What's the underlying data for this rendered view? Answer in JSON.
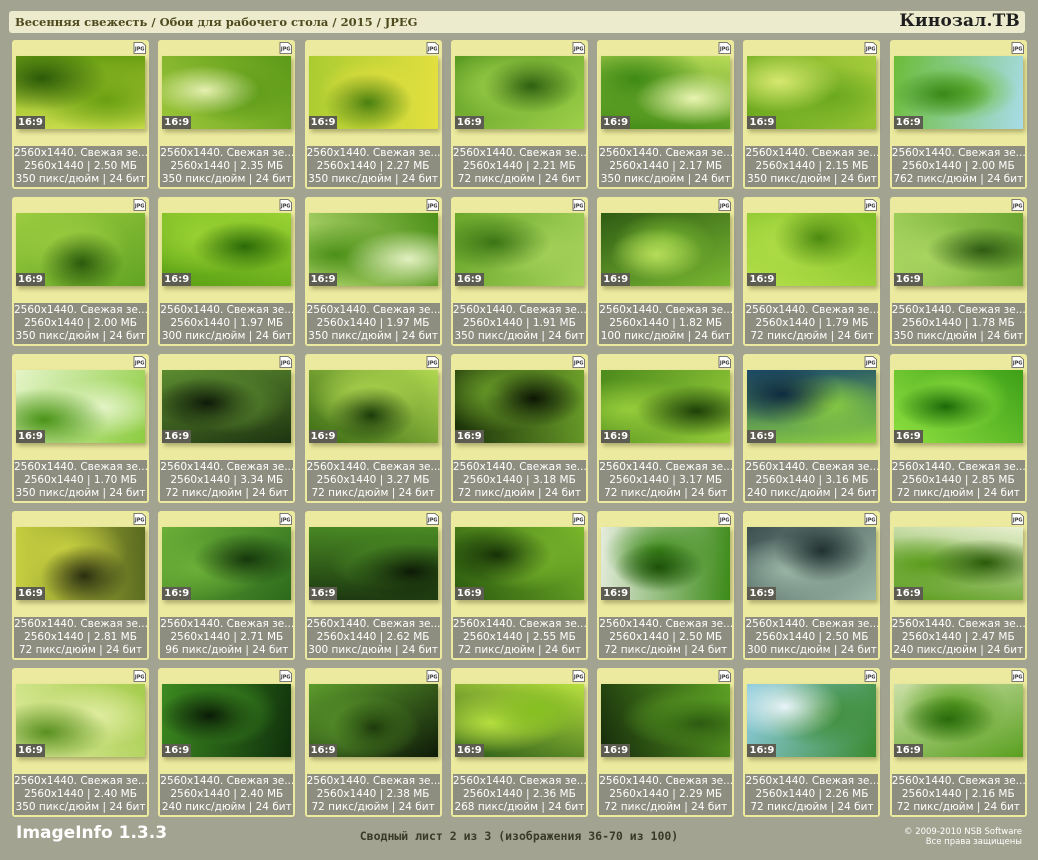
{
  "header": {
    "title": "Весенняя свежесть / Обои для рабочего стола / 2015 / JPEG",
    "brand": "Кинозал.ТВ"
  },
  "footer": {
    "app_name": "ImageInfo 1.3.3",
    "page_info": "Сводный лист 2 из 3 (изображения 36-70 из 100)",
    "copyright_line1": "© 2009-2010 NSB Software",
    "copyright_line2": "Все права защищены"
  },
  "badge_label": "16:9",
  "format_icon_label": "JPG",
  "thumbnails": [
    {
      "line1": "2560x1440. Свежая зе...",
      "line2": "2560x1440 | 2.50 МБ",
      "line3": "350 пикс/дюйм | 24 бит",
      "colors": [
        "#c8dc4a",
        "#6aa012",
        "#2c5a08"
      ]
    },
    {
      "line1": "2560x1440. Свежая зе...",
      "line2": "2560x1440 | 2.35 МБ",
      "line3": "350 пикс/дюйм | 24 бит",
      "colors": [
        "#9cc63a",
        "#5c9a18",
        "#e6f0b0"
      ]
    },
    {
      "line1": "2560x1440. Свежая зе...",
      "line2": "2560x1440 | 2.27 МБ",
      "line3": "350 пикс/дюйм | 24 бит",
      "colors": [
        "#aacc30",
        "#e4e040",
        "#4a8010"
      ]
    },
    {
      "line1": "2560x1440. Свежая зе...",
      "line2": "2560x1440 | 2.21 МБ",
      "line3": "72 пикс/дюйм | 24 бит",
      "colors": [
        "#5a9a22",
        "#9ed04a",
        "#2e6010"
      ]
    },
    {
      "line1": "2560x1440. Свежая зе...",
      "line2": "2560x1440 | 2.17 МБ",
      "line3": "350 пикс/дюйм | 24 бит",
      "colors": [
        "#b8da58",
        "#3e8a14",
        "#e8f4b0"
      ]
    },
    {
      "line1": "2560x1440. Свежая зе...",
      "line2": "2560x1440 | 2.15 МБ",
      "line3": "350 пикс/дюйм | 24 бит",
      "colors": [
        "#a6cc3c",
        "#6aa81e",
        "#d6e870"
      ]
    },
    {
      "line1": "2560x1440. Свежая зе...",
      "line2": "2560x1440 | 2.00 МБ",
      "line3": "762 пикс/дюйм | 24 бит",
      "colors": [
        "#a8dce8",
        "#6cbc38",
        "#3a8818"
      ]
    },
    {
      "line1": "2560x1440. Свежая зе...",
      "line2": "2560x1440 | 2.00 МБ",
      "line3": "350 пикс/дюйм | 24 бит",
      "colors": [
        "#62a424",
        "#9ccc40",
        "#2a5a0c"
      ]
    },
    {
      "line1": "2560x1440. Свежая зе...",
      "line2": "2560x1440 | 1.97 МБ",
      "line3": "300 пикс/дюйм | 24 бит",
      "colors": [
        "#58a014",
        "#9ad232",
        "#2c6a08"
      ]
    },
    {
      "line1": "2560x1440. Свежая зе...",
      "line2": "2560x1440 | 1.97 МБ",
      "line3": "350 пикс/дюйм | 24 бит",
      "colors": [
        "#b4d870",
        "#4c9018",
        "#e2f0c0"
      ]
    },
    {
      "line1": "2560x1440. Свежая зе...",
      "line2": "2560x1440 | 1.91 МБ",
      "line3": "350 пикс/дюйм | 24 бит",
      "colors": [
        "#6aa82c",
        "#a6d25a",
        "#3a7414"
      ]
    },
    {
      "line1": "2560x1440. Свежая зе...",
      "line2": "2560x1440 | 1.82 МБ",
      "line3": "100 пикс/дюйм | 24 бит",
      "colors": [
        "#2e5c14",
        "#7ab832",
        "#b6dc5a"
      ]
    },
    {
      "line1": "2560x1440. Свежая зе...",
      "line2": "2560x1440 | 1.79 МБ",
      "line3": "72 пикс/дюйм | 24 бит",
      "colors": [
        "#7cbc24",
        "#b4e04a",
        "#4c8a10"
      ]
    },
    {
      "line1": "2560x1440. Свежая зе...",
      "line2": "2560x1440 | 1.78 МБ",
      "line3": "350 пикс/дюйм | 24 бит",
      "colors": [
        "#6aa630",
        "#a8d460",
        "#2e5a12"
      ]
    },
    {
      "line1": "2560x1440. Свежая зе...",
      "line2": "2560x1440 | 1.70 МБ",
      "line3": "350 пикс/дюйм | 24 бит",
      "colors": [
        "#8ccc40",
        "#e4f4c8",
        "#4a9418"
      ]
    },
    {
      "line1": "2560x1440. Свежая зе...",
      "line2": "2560x1440 | 3.34 МБ",
      "line3": "72 пикс/дюйм | 24 бит",
      "colors": [
        "#1e3410",
        "#5c8c30",
        "#0e1a08"
      ]
    },
    {
      "line1": "2560x1440. Свежая зе...",
      "line2": "2560x1440 | 3.27 МБ",
      "line3": "72 пикс/дюйм | 24 бит",
      "colors": [
        "#3a6a14",
        "#b0d850",
        "#1c3c0a"
      ]
    },
    {
      "line1": "2560x1440. Свежая зе...",
      "line2": "2560x1440 | 3.18 МБ",
      "line3": "72 пикс/дюйм | 24 бит",
      "colors": [
        "#1a3008",
        "#6ca02a",
        "#0c1604"
      ]
    },
    {
      "line1": "2560x1440. Свежая зе...",
      "line2": "2560x1440 | 3.17 МБ",
      "line3": "72 пикс/дюйм | 24 бит",
      "colors": [
        "#4c8a1c",
        "#96cc3a",
        "#1e4008"
      ]
    },
    {
      "line1": "2560x1440. Свежая зе...",
      "line2": "2560x1440 | 3.16 МБ",
      "line3": "240 пикс/дюйм | 24 бит",
      "colors": [
        "#1c4c6c",
        "#8cd040",
        "#0e2a40"
      ]
    },
    {
      "line1": "2560x1440. Свежая зе...",
      "line2": "2560x1440 | 2.85 МБ",
      "line3": "72 пикс/дюйм | 24 бит",
      "colors": [
        "#3ea018",
        "#8ee040",
        "#1a6a08"
      ]
    },
    {
      "line1": "2560x1440. Свежая зе...",
      "line2": "2560x1440 | 2.81 МБ",
      "line3": "72 пикс/дюйм | 24 бит",
      "colors": [
        "#5a6a20",
        "#c8d040",
        "#2a2e10"
      ]
    },
    {
      "line1": "2560x1440. Свежая зе...",
      "line2": "2560x1440 | 2.71 МБ",
      "line3": "96 пикс/дюйм | 24 бит",
      "colors": [
        "#2c6a1c",
        "#6cb038",
        "#16380c"
      ]
    },
    {
      "line1": "2560x1440. Свежая зе...",
      "line2": "2560x1440 | 2.62 МБ",
      "line3": "300 пикс/дюйм | 24 бит",
      "colors": [
        "#1c3810",
        "#4a8a24",
        "#0c1a06"
      ]
    },
    {
      "line1": "2560x1440. Свежая зе...",
      "line2": "2560x1440 | 2.55 МБ",
      "line3": "72 пикс/дюйм | 24 бит",
      "colors": [
        "#2a5a0e",
        "#7ab82c",
        "#143006"
      ]
    },
    {
      "line1": "2560x1440. Свежая зе...",
      "line2": "2560x1440 | 2.50 МБ",
      "line3": "72 пикс/дюйм | 24 бит",
      "colors": [
        "#e4ecdc",
        "#3c8a18",
        "#1c5008"
      ]
    },
    {
      "line1": "2560x1440. Свежая зе...",
      "line2": "2560x1440 | 2.50 МБ",
      "line3": "300 пикс/дюйм | 24 бит",
      "colors": [
        "#3c5050",
        "#9cb8a8",
        "#203030"
      ]
    },
    {
      "line1": "2560x1440. Свежая зе...",
      "line2": "2560x1440 | 2.47 МБ",
      "line3": "240 пикс/дюйм | 24 бит",
      "colors": [
        "#e8f0d0",
        "#5a9c1c",
        "#2a5a08"
      ]
    },
    {
      "line1": "2560x1440. Свежая зе...",
      "line2": "2560x1440 | 2.40 МБ",
      "line3": "350 пикс/дюйм | 24 бит",
      "colors": [
        "#a4cc4c",
        "#e0eca0",
        "#5a9020"
      ]
    },
    {
      "line1": "2560x1440. Свежая зе...",
      "line2": "2560x1440 | 2.40 МБ",
      "line3": "240 пикс/дюйм | 24 бит",
      "colors": [
        "#10300c",
        "#3c8a20",
        "#0a1c06"
      ]
    },
    {
      "line1": "2560x1440. Свежая зе...",
      "line2": "2560x1440 | 2.38 МБ",
      "line3": "72 пикс/дюйм | 24 бит",
      "colors": [
        "#0e1a08",
        "#5c9c2c",
        "#1e3a0c"
      ]
    },
    {
      "line1": "2560x1440. Свежая зе...",
      "line2": "2560x1440 | 2.36 МБ",
      "line3": "268 пикс/дюйм | 24 бит",
      "colors": [
        "#2c5c18",
        "#b8e040",
        "#86c020"
      ]
    },
    {
      "line1": "2560x1440. Свежая зе...",
      "line2": "2560x1440 | 2.29 МБ",
      "line3": "72 пикс/дюйм | 24 бит",
      "colors": [
        "#142a0a",
        "#5ca024",
        "#2c5a10"
      ]
    },
    {
      "line1": "2560x1440. Свежая зе...",
      "line2": "2560x1440 | 2.26 МБ",
      "line3": "72 пикс/дюйм | 24 бит",
      "colors": [
        "#8ccce0",
        "#3a8a30",
        "#e8f4f8"
      ]
    },
    {
      "line1": "2560x1440. Свежая зе...",
      "line2": "2560x1440 | 2.16 МБ",
      "line3": "72 пикс/дюйм | 24 бит",
      "colors": [
        "#cce0a8",
        "#5aa020",
        "#2a6a0c"
      ]
    }
  ]
}
